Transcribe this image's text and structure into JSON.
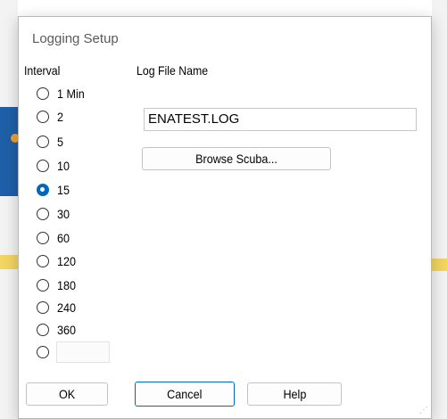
{
  "dialog": {
    "title": "Logging Setup"
  },
  "interval": {
    "label": "Interval",
    "options": [
      {
        "label": "1  Min",
        "checked": false
      },
      {
        "label": "2",
        "checked": false
      },
      {
        "label": "5",
        "checked": false
      },
      {
        "label": "10",
        "checked": false
      },
      {
        "label": "15",
        "checked": true
      },
      {
        "label": "30",
        "checked": false
      },
      {
        "label": "60",
        "checked": false
      },
      {
        "label": "120",
        "checked": false
      },
      {
        "label": "180",
        "checked": false
      },
      {
        "label": "240",
        "checked": false
      },
      {
        "label": "360",
        "checked": false
      }
    ],
    "custom_value": ""
  },
  "log_file": {
    "label": "Log File Name",
    "value": "ENATEST.LOG",
    "browse_label": "Browse Scuba..."
  },
  "buttons": {
    "ok": "OK",
    "cancel": "Cancel",
    "help": "Help"
  },
  "colors": {
    "accent": "#0067c0"
  }
}
